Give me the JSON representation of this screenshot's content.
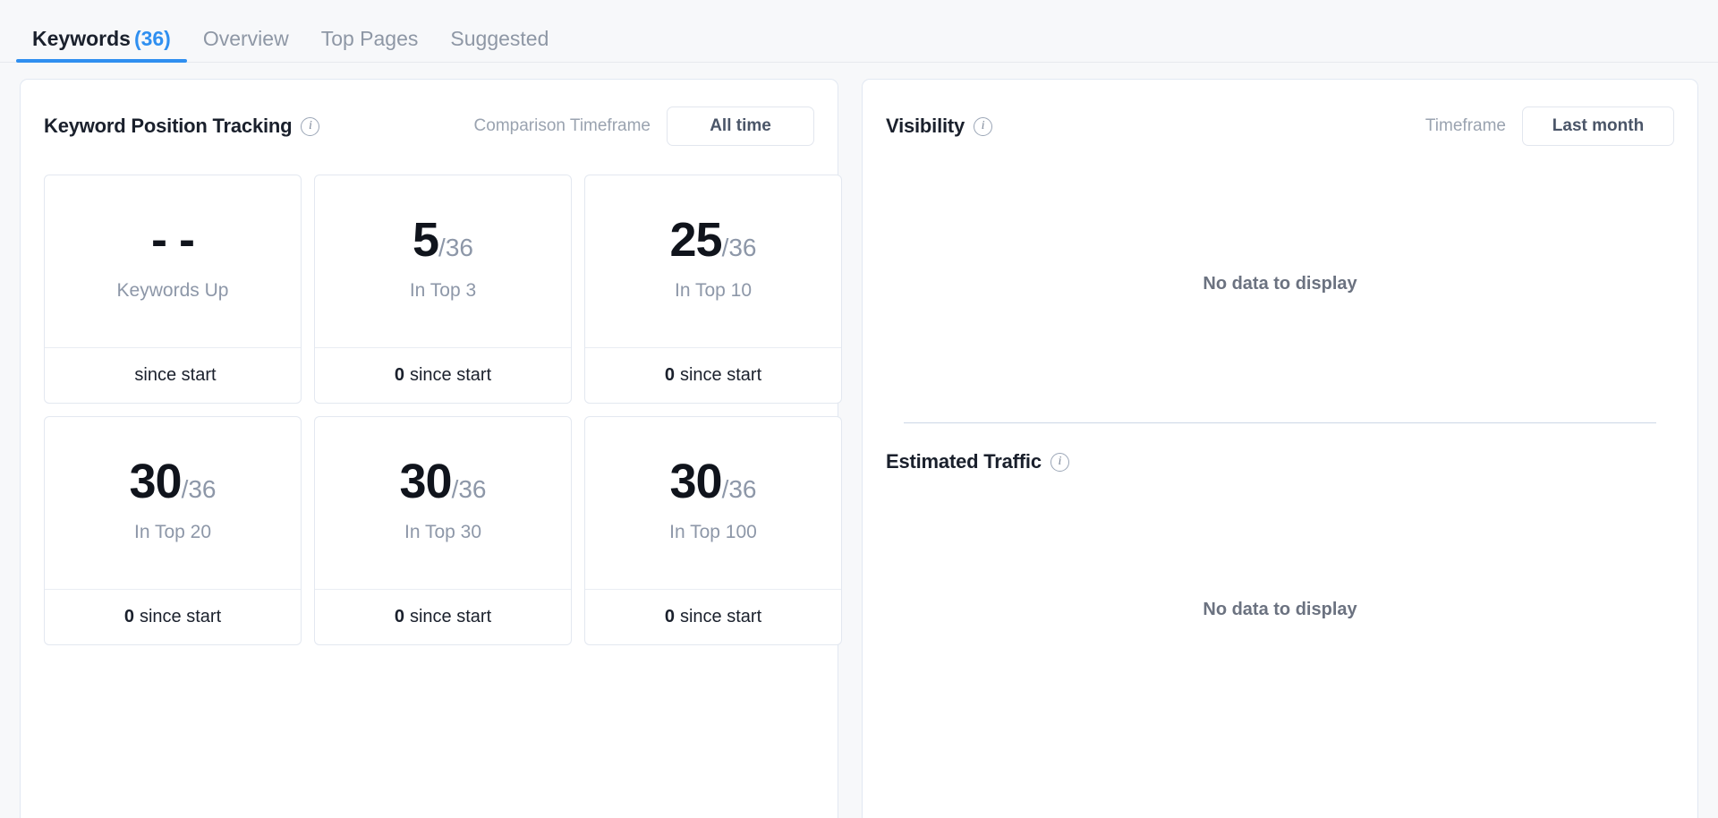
{
  "tabs": [
    {
      "label": "Keywords",
      "count": "(36)",
      "active": true
    },
    {
      "label": "Overview",
      "count": "",
      "active": false
    },
    {
      "label": "Top Pages",
      "count": "",
      "active": false
    },
    {
      "label": "Suggested",
      "count": "",
      "active": false
    }
  ],
  "colors": {
    "accent": "#2f8ff0",
    "page_bg": "#f7f8fa",
    "panel_bg": "#ffffff",
    "panel_border": "#e2e8f2",
    "muted_text": "#8d97a8",
    "strong_text": "#10141c"
  },
  "left_panel": {
    "title": "Keyword Position Tracking",
    "info_icon": "info-circle-icon",
    "comparison_timeframe_label": "Comparison Timeframe",
    "comparison_timeframe_value": "All time",
    "stats": [
      {
        "value": "- -",
        "total": "",
        "label": "Keywords Up",
        "delta": "",
        "delta_suffix": "since start"
      },
      {
        "value": "5",
        "total": "/36",
        "label": "In Top 3",
        "delta": "0",
        "delta_suffix": "since start"
      },
      {
        "value": "25",
        "total": "/36",
        "label": "In Top 10",
        "delta": "0",
        "delta_suffix": "since start"
      },
      {
        "value": "30",
        "total": "/36",
        "label": "In Top 20",
        "delta": "0",
        "delta_suffix": "since start"
      },
      {
        "value": "30",
        "total": "/36",
        "label": "In Top 30",
        "delta": "0",
        "delta_suffix": "since start"
      },
      {
        "value": "30",
        "total": "/36",
        "label": "In Top 100",
        "delta": "0",
        "delta_suffix": "since start"
      }
    ]
  },
  "right_panel": {
    "visibility": {
      "title": "Visibility",
      "info_icon": "info-circle-icon",
      "timeframe_label": "Timeframe",
      "timeframe_value": "Last month",
      "empty_message": "No data to display"
    },
    "estimated_traffic": {
      "title": "Estimated Traffic",
      "info_icon": "info-circle-icon",
      "empty_message": "No data to display"
    }
  }
}
